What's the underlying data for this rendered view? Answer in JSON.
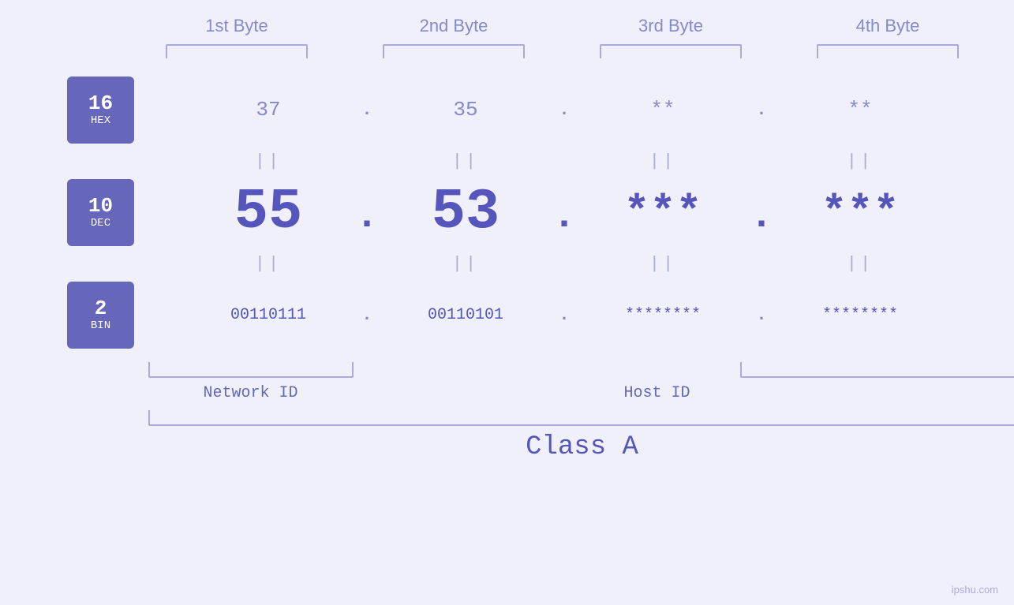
{
  "byteHeaders": [
    "1st Byte",
    "2nd Byte",
    "3rd Byte",
    "4th Byte"
  ],
  "badges": [
    {
      "number": "16",
      "label": "HEX"
    },
    {
      "number": "10",
      "label": "DEC"
    },
    {
      "number": "2",
      "label": "BIN"
    }
  ],
  "rows": [
    {
      "values": [
        "37",
        "35",
        "**",
        "**"
      ],
      "dots": [
        ".",
        ".",
        "."
      ],
      "size": "medium"
    },
    {
      "values": [
        "55",
        "53",
        "***",
        "***"
      ],
      "dots": [
        ".",
        ".",
        "."
      ],
      "size": "large"
    },
    {
      "values": [
        "00110111",
        "00110101",
        "********",
        "********"
      ],
      "dots": [
        ".",
        ".",
        "."
      ],
      "size": "small"
    }
  ],
  "equals": [
    "||",
    "||",
    "||",
    "||"
  ],
  "networkIdLabel": "Network ID",
  "hostIdLabel": "Host ID",
  "classLabel": "Class A",
  "watermark": "ipshu.com"
}
